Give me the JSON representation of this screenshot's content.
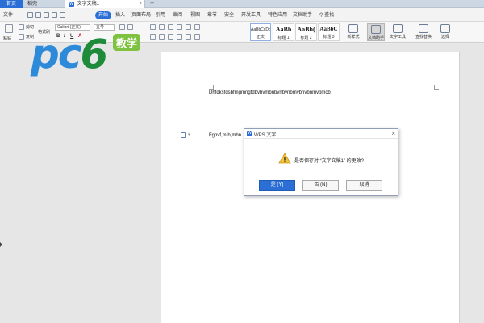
{
  "tabs": {
    "home": "首页",
    "draft": "稻壳",
    "doc": "文字文稿1",
    "close": "×",
    "new": "+"
  },
  "menu": [
    "文件",
    "开始",
    "插入",
    "页面布局",
    "引用",
    "审阅",
    "视图",
    "章节",
    "安全",
    "开发工具",
    "特色应用",
    "文档助手",
    "查找"
  ],
  "ribbon": {
    "paste": "粘贴",
    "cut": "剪切",
    "copy": "复制",
    "format_painter": "格式刷",
    "font_name": "Calibri (正文)",
    "font_size": "五号",
    "styles": [
      {
        "sample": "AaBbCcDd",
        "name": "正文"
      },
      {
        "sample": "AaBb",
        "name": "标题 1"
      },
      {
        "sample": "AaBb(",
        "name": "标题 2"
      },
      {
        "sample": "AaBbC",
        "name": "标题 3"
      }
    ],
    "new_style": "新样式",
    "doc_helper": "文档助手",
    "text_tools": "文字工具",
    "find_replace": "查找替换",
    "select": "选择"
  },
  "logo": {
    "text_a": "pc",
    "text_b": "6",
    "badge": "教学"
  },
  "document": {
    "line1": "Dhfdksfdsbfmgmngfdbvbvmbnbvnbvnbmvbnvbnmvbmcb",
    "line2": "Fgnvf,m,b,mbn"
  },
  "dialog": {
    "title": "WPS 文字",
    "message": "是否保存对 “文字文稿1” 的更改?",
    "yes": "是 (Y)",
    "no": "否 (N)",
    "cancel": "取消",
    "close": "×"
  },
  "colors": {
    "accent": "#2b6fd6",
    "logo_blue": "#2d8ad9",
    "logo_green": "#7fc242"
  }
}
